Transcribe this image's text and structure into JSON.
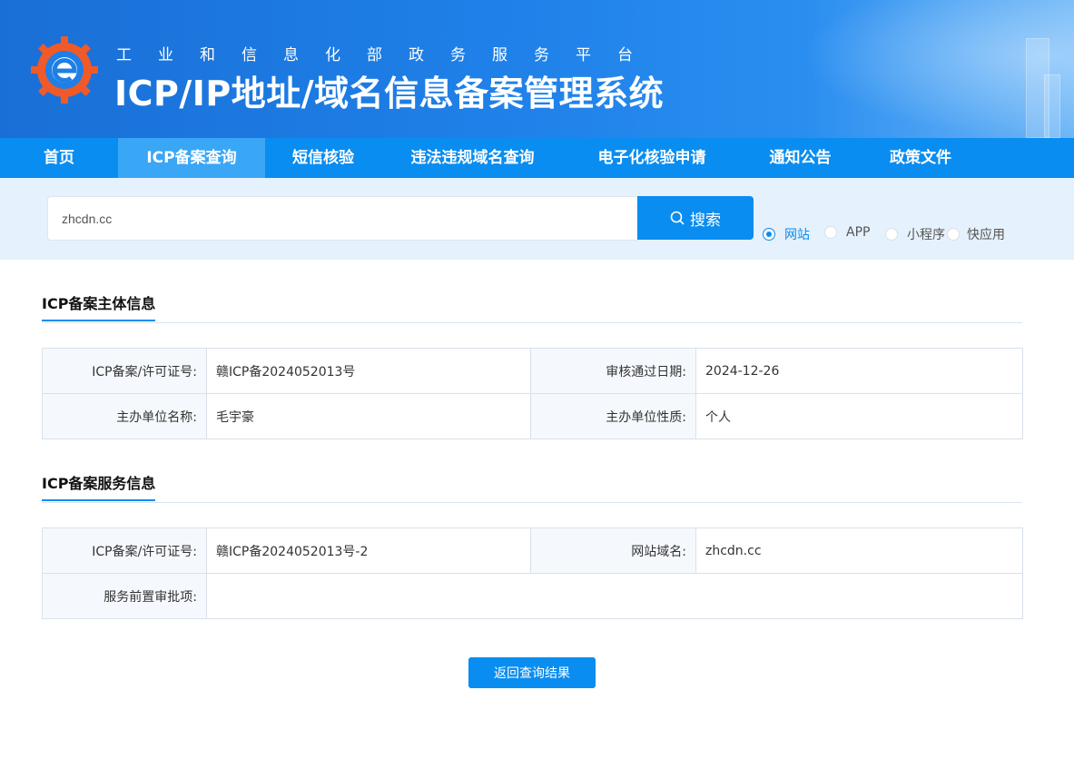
{
  "header": {
    "gov_subtitle": "工业和信息化部政务服务平台",
    "system_title": "ICP/IP地址/域名信息备案管理系统"
  },
  "nav": {
    "items": [
      {
        "label": "首页"
      },
      {
        "label": "ICP备案查询"
      },
      {
        "label": "短信核验"
      },
      {
        "label": "违法违规域名查询"
      },
      {
        "label": "电子化核验申请"
      },
      {
        "label": "通知公告"
      },
      {
        "label": "政策文件"
      }
    ],
    "active_index": 1
  },
  "search": {
    "value": "zhcdn.cc",
    "button_label": "搜索",
    "types": [
      {
        "label": "网站",
        "checked": true
      },
      {
        "label": "APP",
        "checked": false
      },
      {
        "label": "小程序",
        "checked": false
      },
      {
        "label": "快应用",
        "checked": false
      }
    ]
  },
  "subject_info": {
    "title": "ICP备案主体信息",
    "license_label": "ICP备案/许可证号:",
    "license_value": "赣ICP备2024052013号",
    "approval_date_label": "审核通过日期:",
    "approval_date_value": "2024-12-26",
    "org_name_label": "主办单位名称:",
    "org_name_value": "毛宇豪",
    "org_nature_label": "主办单位性质:",
    "org_nature_value": "个人"
  },
  "service_info": {
    "title": "ICP备案服务信息",
    "license_label": "ICP备案/许可证号:",
    "license_value": "赣ICP备2024052013号-2",
    "domain_label": "网站域名:",
    "domain_value": "zhcdn.cc",
    "pre_approval_label": "服务前置审批项:",
    "pre_approval_value": ""
  },
  "back_button_label": "返回查询结果",
  "colors": {
    "primary": "#0a8df0",
    "nav_active": "#3aa6f6",
    "search_bg": "#e5f1fc",
    "label_cell_bg": "#f5f9fd"
  },
  "icons": {
    "logo": "miit-gear-e-logo",
    "search": "search-icon"
  }
}
